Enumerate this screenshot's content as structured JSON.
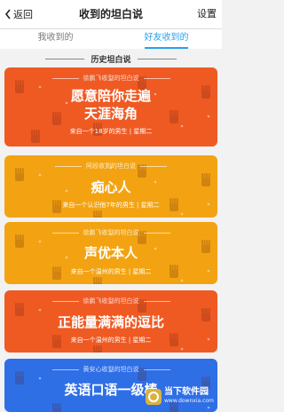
{
  "nav": {
    "back_label": "返回",
    "title": "收到的坦白说",
    "settings_label": "设置"
  },
  "tabs": [
    {
      "label": "我收到的"
    },
    {
      "label": "好友收到的"
    }
  ],
  "section_title": "历史坦白说",
  "cards": [
    {
      "header": "徐鹏飞收到的坦白说",
      "message_line1": "愿意陪你走遍",
      "message_line2": "天涯海角",
      "sub": "来自一个18岁的男生 | 星期二",
      "color": "#ef5a23"
    },
    {
      "header": "阿段收到的坦白说",
      "message_line1": "痴心人",
      "message_line2": "",
      "sub": "来自一个认识他7年的男生 | 星期二",
      "color": "#f3a312"
    },
    {
      "header": "徐鹏飞收到的坦白说",
      "message_line1": "声优本人",
      "message_line2": "",
      "sub": "来自一个温州的男生 | 星期二",
      "color": "#f3a312"
    },
    {
      "header": "徐鹏飞收到的坦白说",
      "message_line1": "正能量满满的逗比",
      "message_line2": "",
      "sub": "来自一个温州的男生 | 星期二",
      "color": "#ef5a23"
    },
    {
      "header": "黄安心收到的坦白说",
      "message_line1": "英语口语一级棒",
      "message_line2": "",
      "sub": "",
      "color": "#2f6fe6"
    }
  ],
  "watermark": {
    "title": "当下软件园",
    "subtitle": "www.downxia.com"
  },
  "colors": {
    "accent": "#2aa0ea"
  }
}
